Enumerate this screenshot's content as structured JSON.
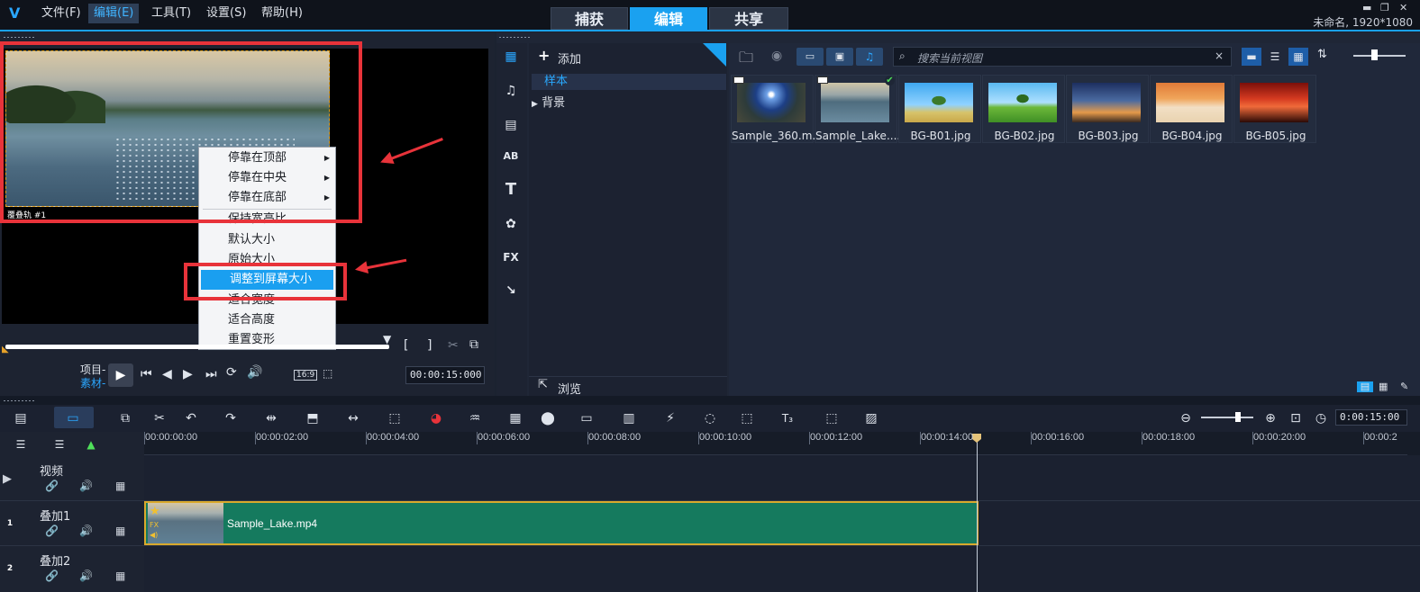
{
  "menu": {
    "file": "文件(F)",
    "edit": "编辑(E)",
    "tools": "工具(T)",
    "settings": "设置(S)",
    "help": "帮助(H)"
  },
  "modes": {
    "capture": "捕获",
    "edit": "编辑",
    "share": "共享"
  },
  "project_info": "未命名, 1920*1080",
  "preview": {
    "overlay_label": "覆叠轨 #1",
    "project_label": "项目-",
    "clip_label": "素材-",
    "aspect": "16:9",
    "timecode": "00:00:15:000"
  },
  "context_menu": {
    "items": [
      {
        "label": "停靠在顶部",
        "has_sub": true
      },
      {
        "label": "停靠在中央",
        "has_sub": true
      },
      {
        "label": "停靠在底部",
        "has_sub": true
      },
      {
        "label": "保持宽高比"
      },
      {
        "label": "默认大小"
      },
      {
        "label": "原始大小"
      },
      {
        "label": "调整到屏幕大小",
        "highlighted": true
      },
      {
        "label": "适合宽度"
      },
      {
        "label": "适合高度"
      },
      {
        "label": "重置变形"
      }
    ]
  },
  "library": {
    "add_label": "添加",
    "folders": [
      "样本",
      "背景"
    ],
    "browse_label": "浏览",
    "search_placeholder": "搜索当前视图",
    "thumbnails": [
      {
        "name": "Sample_360.m...",
        "type": "video"
      },
      {
        "name": "Sample_Lake....",
        "type": "video",
        "used": true
      },
      {
        "name": "BG-B01.jpg",
        "type": "image"
      },
      {
        "name": "BG-B02.jpg",
        "type": "image"
      },
      {
        "name": "BG-B03.jpg",
        "type": "image"
      },
      {
        "name": "BG-B04.jpg",
        "type": "image"
      },
      {
        "name": "BG-B05.jpg",
        "type": "image"
      }
    ]
  },
  "timeline": {
    "timecode": "0:00:15:00",
    "ruler_ticks": [
      "00:00:00:00",
      "00:00:02:00",
      "00:00:04:00",
      "00:00:06:00",
      "00:00:08:00",
      "00:00:10:00",
      "00:00:12:00",
      "00:00:14:00",
      "00:00:16:00",
      "00:00:18:00",
      "00:00:20:00",
      "00:00:2"
    ],
    "tracks": [
      {
        "name": "视频",
        "num": ""
      },
      {
        "name": "叠加1",
        "num": "1"
      },
      {
        "name": "叠加2",
        "num": "2"
      }
    ],
    "clip_name": "Sample_Lake.mp4"
  },
  "colors": {
    "accent": "#1aa1f0",
    "annotation": "#e8333a",
    "clip": "#157a5e"
  }
}
